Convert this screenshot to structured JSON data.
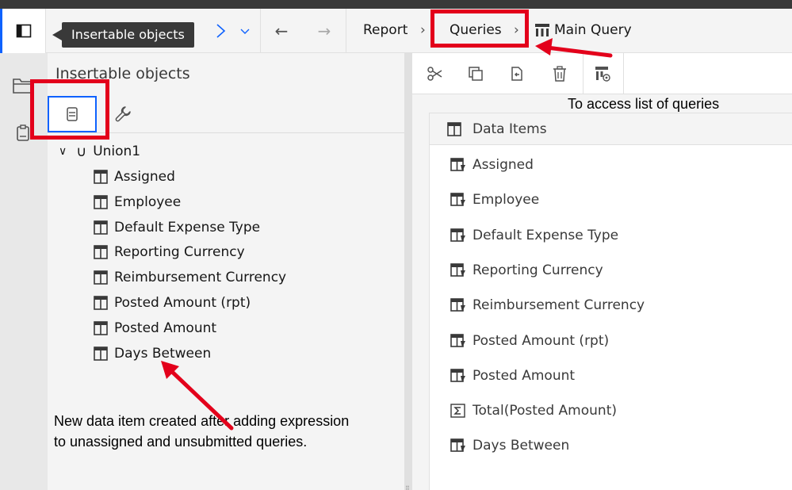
{
  "toolbar": {
    "breadcrumbs": [
      {
        "label": "Report"
      },
      {
        "label": "Queries"
      },
      {
        "label": "Main Query"
      }
    ],
    "back_glyph": "←",
    "forward_glyph": "→",
    "chevron_glyph": "›",
    "icons": [
      "panel-toggle-icon",
      "redo-icon",
      "dropdown-chevron-icon",
      "back-arrow-icon",
      "forward-arrow-icon",
      "query-icon"
    ]
  },
  "tooltip": {
    "text": "Insertable objects"
  },
  "insertable_panel": {
    "title": "Insertable objects",
    "tabs": [
      {
        "name": "data-items-tab",
        "icon": "data-items-icon",
        "active": true
      },
      {
        "name": "toolbox-tab",
        "icon": "wrench-icon",
        "active": false
      }
    ],
    "root": {
      "label": "Union1",
      "icon": "union-icon",
      "expanded": true
    },
    "items": [
      "Assigned",
      "Employee",
      "Default Expense Type",
      "Reporting Currency",
      "Reimbursement Currency",
      "Posted Amount (rpt)",
      "Posted Amount",
      "Days Between"
    ]
  },
  "query_toolbar": {
    "icons": [
      "cut-icon",
      "copy-icon",
      "paste-icon",
      "delete-icon",
      "query-properties-icon"
    ]
  },
  "data_items_panel": {
    "header": "Data Items",
    "items": [
      {
        "label": "Assigned",
        "icon": "data-item-icon"
      },
      {
        "label": "Employee",
        "icon": "data-item-icon"
      },
      {
        "label": "Default Expense Type",
        "icon": "data-item-icon"
      },
      {
        "label": "Reporting Currency",
        "icon": "data-item-icon"
      },
      {
        "label": "Reimbursement Currency",
        "icon": "data-item-icon"
      },
      {
        "label": "Posted Amount (rpt)",
        "icon": "data-item-icon"
      },
      {
        "label": "Posted Amount",
        "icon": "data-item-icon"
      },
      {
        "label": "Total(Posted Amount)",
        "icon": "sigma-icon"
      },
      {
        "label": "Days Between",
        "icon": "data-item-icon"
      }
    ]
  },
  "annotations": {
    "queries_note": "To access list of queries",
    "new_item_note_line1": "New data item created after adding expression",
    "new_item_note_line2": "to unassigned and unsubmitted queries."
  },
  "colors": {
    "highlight": "#e3001b",
    "accent": "#0f62fe",
    "tooltip_bg": "#393939",
    "panel_bg": "#f4f4f4"
  }
}
